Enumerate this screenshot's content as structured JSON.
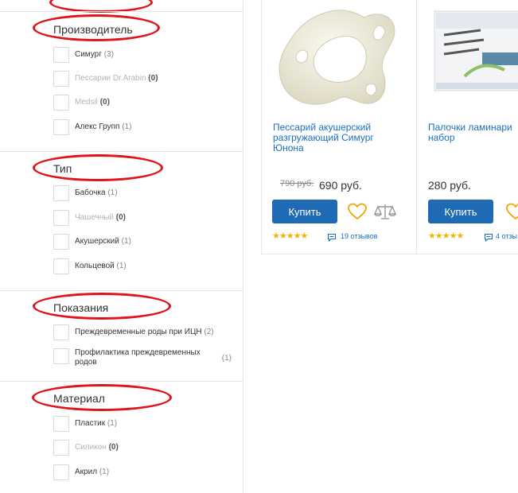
{
  "filters": [
    {
      "title": "Производитель",
      "options": [
        {
          "label": "Симург",
          "count": "(3)",
          "disabled": false
        },
        {
          "label": "Пессарии Dr.Arabin",
          "count": "(0)",
          "disabled": true
        },
        {
          "label": "Medsil",
          "count": "(0)",
          "disabled": true
        },
        {
          "label": "Алекс Групп",
          "count": "(1)",
          "disabled": false
        }
      ]
    },
    {
      "title": "Тип",
      "options": [
        {
          "label": "Бабочка",
          "count": "(1)",
          "disabled": false
        },
        {
          "label": "Чашечный",
          "count": "(0)",
          "disabled": true
        },
        {
          "label": "Акушерский",
          "count": "(1)",
          "disabled": false
        },
        {
          "label": "Кольцевой",
          "count": "(1)",
          "disabled": false
        }
      ]
    },
    {
      "title": "Показания",
      "options": [
        {
          "label": "Преждевременные роды при ИЦН",
          "count": "(2)",
          "disabled": false
        },
        {
          "label": "Профилактика преждевременных родов",
          "count": "(1)",
          "disabled": false
        }
      ]
    },
    {
      "title": "Материал",
      "options": [
        {
          "label": "Пластик",
          "count": "(1)",
          "disabled": false
        },
        {
          "label": "Силикон",
          "count": "(0)",
          "disabled": true
        },
        {
          "label": "Акрил",
          "count": "(1)",
          "disabled": false
        }
      ]
    }
  ],
  "products": [
    {
      "title": "Пессарий акушерский разгружающий Симург Юнона",
      "old_price": "790 руб.",
      "price": "690 руб.",
      "buy_label": "Купить",
      "rating_stars": "★★★★★",
      "rating": 5,
      "reviews": "19 отзывов"
    },
    {
      "title": "Палочки ламинари набор",
      "old_price": "",
      "price": "280 руб.",
      "buy_label": "Купить",
      "rating_stars": "★★★★★",
      "rating": 5,
      "reviews": "4 отзы"
    }
  ],
  "colors": {
    "accent": "#1f6ab4",
    "link": "#1a6fc2",
    "annotation": "#e0141b",
    "stars": "#f5b301"
  },
  "icons": [
    "checkbox",
    "heart-icon",
    "compare-scales-icon",
    "star-icon",
    "chat-bubble-icon"
  ]
}
